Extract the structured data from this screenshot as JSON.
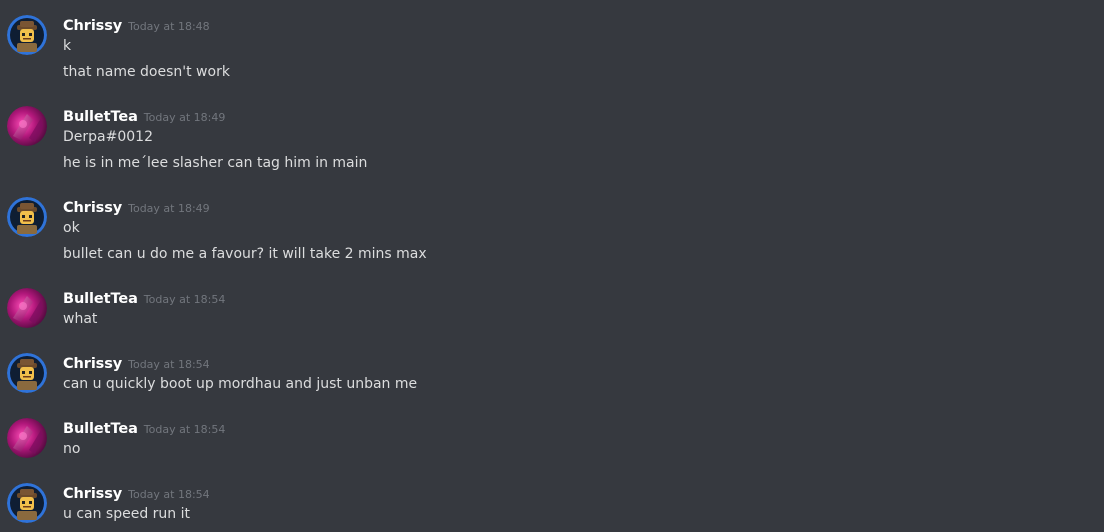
{
  "messages": [
    {
      "author": "Chrissy",
      "avatar": "lego-adventurer-icon",
      "timestamp": "Today at 18:48",
      "lines": [
        "k",
        "that name doesn't work"
      ]
    },
    {
      "author": "BulletTea",
      "avatar": "magenta-abstract-avatar-icon",
      "timestamp": "Today at 18:49",
      "lines": [
        "Derpa#0012",
        "he is in me´lee slasher can tag him in main"
      ]
    },
    {
      "author": "Chrissy",
      "avatar": "lego-adventurer-icon",
      "timestamp": "Today at 18:49",
      "lines": [
        "ok",
        "bullet can u do me a favour?  it will take 2 mins max"
      ]
    },
    {
      "author": "BulletTea",
      "avatar": "magenta-abstract-avatar-icon",
      "timestamp": "Today at 18:54",
      "lines": [
        "what"
      ]
    },
    {
      "author": "Chrissy",
      "avatar": "lego-adventurer-icon",
      "timestamp": "Today at 18:54",
      "lines": [
        "can u quickly boot up mordhau and just unban me"
      ]
    },
    {
      "author": "BulletTea",
      "avatar": "magenta-abstract-avatar-icon",
      "timestamp": "Today at 18:54",
      "lines": [
        "no"
      ]
    },
    {
      "author": "Chrissy",
      "avatar": "lego-adventurer-icon",
      "timestamp": "Today at 18:54",
      "lines": [
        "u can speed run it"
      ]
    }
  ],
  "colors": {
    "background": "#36393f",
    "username": "#ffffff",
    "timestamp": "#72767d",
    "message_text": "#dcddde",
    "chrissy_avatar_ring": "#2f73d9",
    "bullettea_avatar_base": "#b0177a"
  }
}
